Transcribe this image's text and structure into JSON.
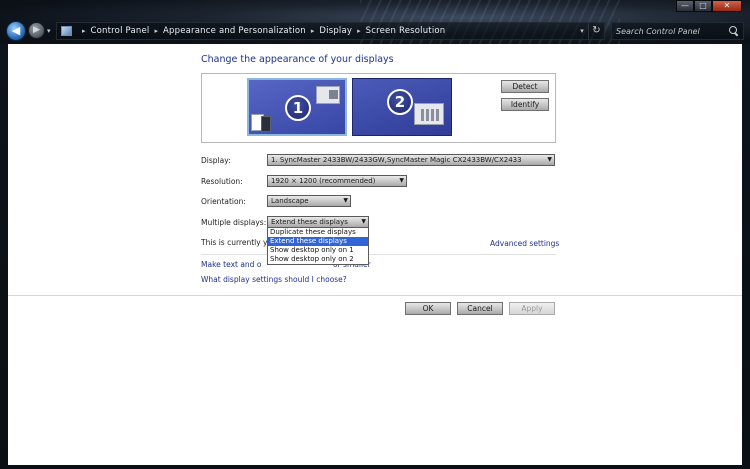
{
  "window": {
    "buttons": [
      "—",
      "□",
      "✕"
    ]
  },
  "nav": {
    "back_glyph": "◀",
    "forward_glyph": "▶"
  },
  "address": {
    "crumbs": [
      "Control Panel",
      "Appearance and Personalization",
      "Display",
      "Screen Resolution"
    ]
  },
  "search": {
    "placeholder": "Search Control Panel"
  },
  "page": {
    "title": "Change the appearance of your displays",
    "monitors": [
      "1",
      "2"
    ],
    "detect_label": "Detect",
    "identify_label": "Identify"
  },
  "settings": {
    "display_label": "Display:",
    "display_value": "1. SyncMaster 2433BW/2433GW,SyncMaster Magic CX2433BW/CX2433",
    "resolution_label": "Resolution:",
    "resolution_value": "1920 × 1200 (recommended)",
    "orientation_label": "Orientation:",
    "orientation_value": "Landscape",
    "multiple_label": "Multiple displays:",
    "multiple_value": "Extend these displays",
    "multiple_options": [
      "Duplicate these displays",
      "Extend these displays",
      "Show desktop only on 1",
      "Show desktop only on 2"
    ],
    "multiple_selected_index": 1
  },
  "info": {
    "current_text": "This is currently you",
    "advanced_link": "Advanced settings",
    "link_make_text": "Make text and other",
    "link_make_text_tail": "or smaller",
    "link_which": "What display settings should I choose?"
  },
  "footer": {
    "ok_label": "OK",
    "cancel_label": "Cancel",
    "apply_label": "Apply"
  },
  "colors": {
    "link": "#1e3287",
    "selection": "#3165d6",
    "monitor_fill": "#4c5ab9"
  }
}
